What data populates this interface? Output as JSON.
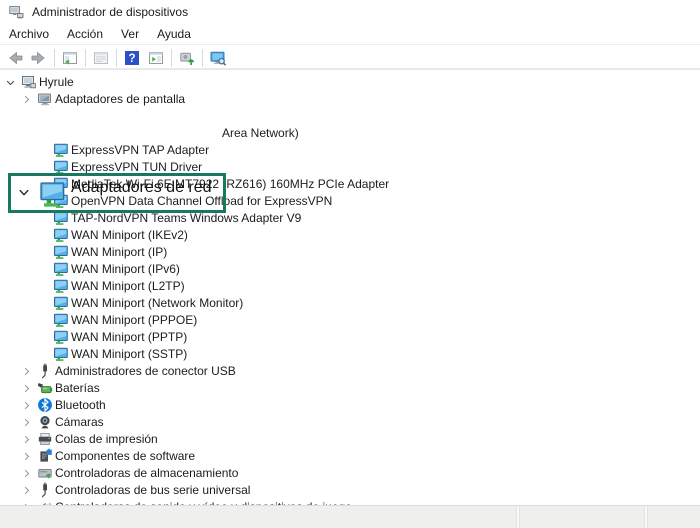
{
  "window": {
    "title": "Administrador de dispositivos",
    "controls": [
      {
        "name": "minimize"
      },
      {
        "name": "maximize"
      },
      {
        "name": "close"
      }
    ]
  },
  "menu": {
    "items": [
      "Archivo",
      "Acción",
      "Ver",
      "Ayuda"
    ]
  },
  "toolbar": {
    "groups": [
      [
        "back-icon",
        "forward-icon"
      ],
      [
        "show-console-tree-icon"
      ],
      [
        "properties-icon"
      ],
      [
        "help-icon",
        "show-action-pane-icon"
      ],
      [
        "scan-hardware-changes-icon"
      ],
      [
        "device-manager-icon"
      ]
    ]
  },
  "highlight": {
    "color": "#17795f",
    "label": "Adaptadores de red"
  },
  "tree": {
    "items": [
      {
        "label": "Hyrule",
        "level": 0,
        "chevron": "expanded",
        "icon": "computer-icon"
      },
      {
        "label": "Adaptadores de pantalla",
        "level": 1,
        "chevron": "collapsed",
        "icon": "display-adapter-icon"
      },
      {
        "label": "Adaptadores de red",
        "level": 1,
        "chevron": "expanded",
        "icon": "network-adapter-icon",
        "highlighted": true
      },
      {
        "label": "Area Network)",
        "level": 2,
        "chevron": "none",
        "icon": "network-adapter-icon",
        "partial": true
      },
      {
        "label": "ExpressVPN TAP Adapter",
        "level": 2,
        "chevron": "none",
        "icon": "network-adapter-icon"
      },
      {
        "label": "ExpressVPN TUN Driver",
        "level": 2,
        "chevron": "none",
        "icon": "network-adapter-icon"
      },
      {
        "label": "MediaTek Wi-Fi 6E MT7922 (RZ616) 160MHz PCIe Adapter",
        "level": 2,
        "chevron": "none",
        "icon": "network-adapter-icon"
      },
      {
        "label": "OpenVPN Data Channel Offload for ExpressVPN",
        "level": 2,
        "chevron": "none",
        "icon": "network-adapter-icon"
      },
      {
        "label": "TAP-NordVPN Teams Windows Adapter V9",
        "level": 2,
        "chevron": "none",
        "icon": "network-adapter-icon"
      },
      {
        "label": "WAN Miniport (IKEv2)",
        "level": 2,
        "chevron": "none",
        "icon": "network-adapter-icon"
      },
      {
        "label": "WAN Miniport (IP)",
        "level": 2,
        "chevron": "none",
        "icon": "network-adapter-icon"
      },
      {
        "label": "WAN Miniport (IPv6)",
        "level": 2,
        "chevron": "none",
        "icon": "network-adapter-icon"
      },
      {
        "label": "WAN Miniport (L2TP)",
        "level": 2,
        "chevron": "none",
        "icon": "network-adapter-icon"
      },
      {
        "label": "WAN Miniport (Network Monitor)",
        "level": 2,
        "chevron": "none",
        "icon": "network-adapter-icon"
      },
      {
        "label": "WAN Miniport (PPPOE)",
        "level": 2,
        "chevron": "none",
        "icon": "network-adapter-icon"
      },
      {
        "label": "WAN Miniport (PPTP)",
        "level": 2,
        "chevron": "none",
        "icon": "network-adapter-icon"
      },
      {
        "label": "WAN Miniport (SSTP)",
        "level": 2,
        "chevron": "none",
        "icon": "network-adapter-icon"
      },
      {
        "label": "Administradores de conector USB",
        "level": 1,
        "chevron": "collapsed",
        "icon": "usb-icon"
      },
      {
        "label": "Baterías",
        "level": 1,
        "chevron": "collapsed",
        "icon": "battery-icon"
      },
      {
        "label": "Bluetooth",
        "level": 1,
        "chevron": "collapsed",
        "icon": "bluetooth-icon"
      },
      {
        "label": "Cámaras",
        "level": 1,
        "chevron": "collapsed",
        "icon": "camera-icon"
      },
      {
        "label": "Colas de impresión",
        "level": 1,
        "chevron": "collapsed",
        "icon": "printer-icon"
      },
      {
        "label": "Componentes de software",
        "level": 1,
        "chevron": "collapsed",
        "icon": "software-component-icon"
      },
      {
        "label": "Controladoras de almacenamiento",
        "level": 1,
        "chevron": "collapsed",
        "icon": "storage-icon"
      },
      {
        "label": "Controladoras de bus serie universal",
        "level": 1,
        "chevron": "collapsed",
        "icon": "usb-icon"
      },
      {
        "label": "Controladoras de sonido y vídeo y dispositivos de juego",
        "level": 1,
        "chevron": "collapsed",
        "icon": "audio-icon"
      }
    ]
  },
  "colors": {
    "accent_green": "#17795f",
    "help_blue": "#2d4fc8",
    "footer_bg": "#efefee"
  }
}
